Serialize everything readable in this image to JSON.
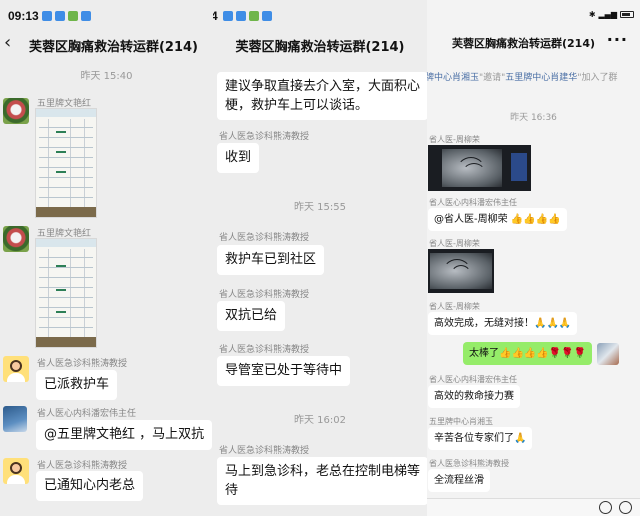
{
  "panel1": {
    "time": "09:13",
    "title": "芙蓉区胸痛救治转运群(214)",
    "timestamp": "昨天 15:40",
    "messages": [
      {
        "sender": "五里牌文艳红"
      },
      {
        "sender": "五里牌文艳红"
      },
      {
        "sender": "省人医急诊科熊涛教授",
        "text": "已派救护车"
      },
      {
        "sender": "省人医心内科潘宏伟主任",
        "text": "@五里牌文艳红 ，马上双抗"
      },
      {
        "sender": "省人医急诊科熊涛教授",
        "text": "已通知心内老总"
      }
    ]
  },
  "panel2": {
    "time_fragment": "4",
    "title": "芙蓉区胸痛救治转运群(214)",
    "first_bubble": [
      "建议争取直接去介入室，大面积心",
      "梗，救护车上可以谈话。"
    ],
    "msg2_sender": "省人医急诊科熊涛教授",
    "msg2_text": "收到",
    "timestamp1": "昨天 15:55",
    "msg3_sender": "省人医急诊科熊涛教授",
    "msg3_text": "救护车已到社区",
    "msg4_sender": "省人医急诊科熊涛教授",
    "msg4_text": "双抗已给",
    "msg5_sender": "省人医急诊科熊涛教授",
    "msg5_text": "导管室已处于等待中",
    "timestamp2": "昨天 16:02",
    "msg6_sender": "省人医急诊科熊涛教授",
    "msg6_text": [
      "马上到急诊科，老总在控制电梯等",
      "待"
    ]
  },
  "panel3": {
    "title": "芙蓉区胸痛救治转运群(214)",
    "more": "···",
    "system_notice_pre": "牌中心肖湘玉",
    "system_notice_mid": "\"邀请\"",
    "system_notice_who": "五里牌中心肖建华",
    "system_notice_post": "\"加入了群",
    "timestamp": "昨天 16:36",
    "m1_sender": "省人医-周柳荣",
    "m2_sender": "省人医心内科潘宏伟主任",
    "m2_text": "@省人医-周柳荣 👍👍👍👍",
    "m3_sender": "省人医-周柳荣",
    "m4_sender": "省人医-周柳荣",
    "m4_text": "高效完成，无缝对接！🙏🙏🙏",
    "m5_text": "太棒了👍👍👍👍🌹🌹🌹",
    "m6_sender": "省人医心内科潘宏伟主任",
    "m6_text": "高效的救命接力赛",
    "m7_sender": "五里牌中心肖湘玉",
    "m7_text": "辛苦各位专家们了🙏",
    "m8_sender": "省人医急诊科熊涛教授",
    "m8_text": "全流程丝滑"
  },
  "colors": {
    "chat_bg": "#ededed",
    "self_bubble": "#95ec69",
    "link": "#4a6fa5"
  }
}
